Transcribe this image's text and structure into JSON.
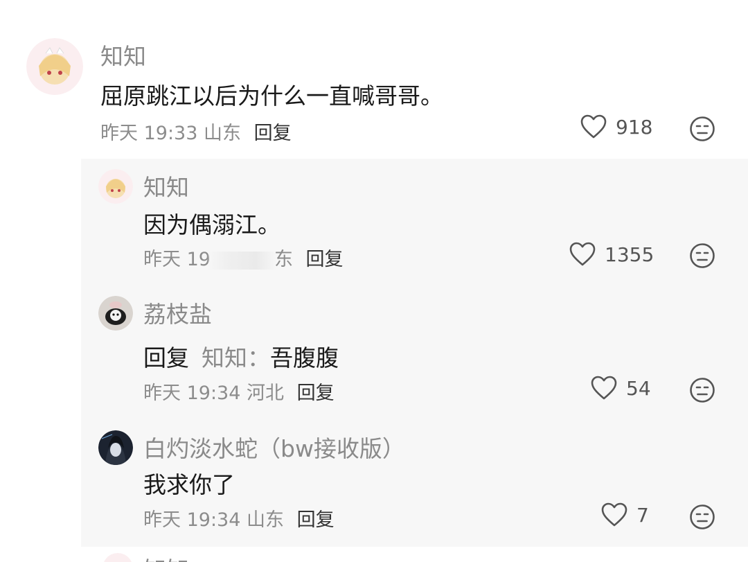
{
  "main_comment": {
    "user": "知知",
    "text": "屈原跳江以后为什么一直喊哥哥。",
    "time": "昨天 19:33",
    "location": "山东",
    "reply_label": "回复",
    "likes": "918"
  },
  "replies": [
    {
      "user": "知知",
      "text": "因为偶溺江。",
      "time_partial": "昨天 1",
      "time_tail": "9",
      "location_partial": "东",
      "reply_label": "回复",
      "likes": "1355"
    },
    {
      "user": "荔枝盐",
      "reply_prefix": "回复",
      "reply_target": "知知：",
      "text": "吾腹腹",
      "time": "昨天 19:34",
      "location": "河北",
      "reply_label": "回复",
      "likes": "54"
    },
    {
      "user": "白灼淡水蛇（bw接收版）",
      "text": "我求你了",
      "time": "昨天 19:34",
      "location": "山东",
      "reply_label": "回复",
      "likes": "7"
    }
  ],
  "next_comment": {
    "user": "知知"
  },
  "icons": {
    "like": "heart-outline-icon",
    "dislike": "meh-face-icon"
  }
}
